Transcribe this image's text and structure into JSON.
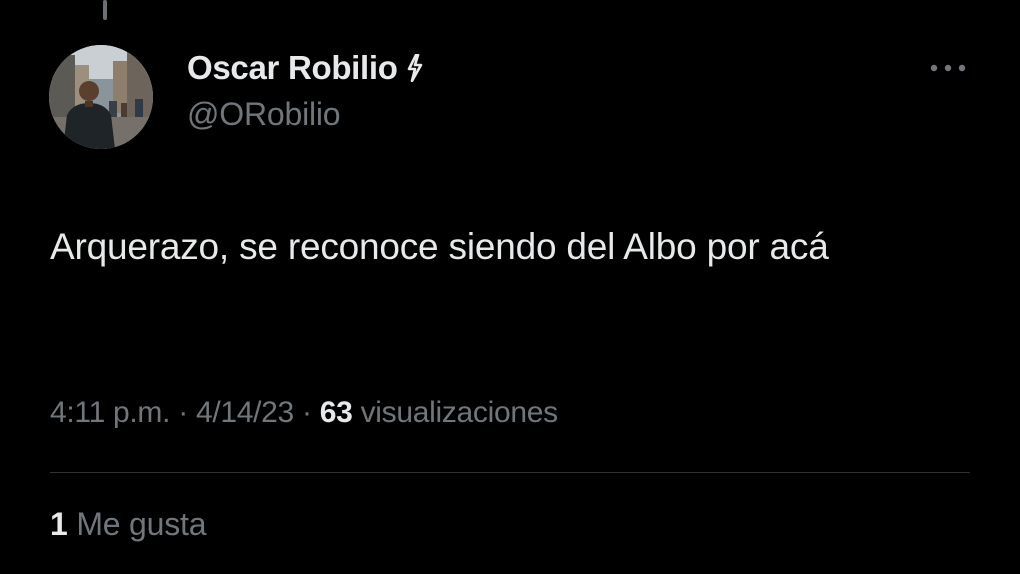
{
  "tweet": {
    "author": {
      "display_name": "Oscar Robilio",
      "badge_icon": "lightning-bolt-icon",
      "handle": "@ORobilio"
    },
    "more_icon": "more-options-icon",
    "text": "Arquerazo, se reconoce siendo del Albo por acá",
    "meta": {
      "time": "4:11 p.m.",
      "separator": "·",
      "date": "4/14/23",
      "views_count": "63",
      "views_label": "visualizaciones"
    },
    "engagement": {
      "likes_count": "1",
      "likes_label": "Me gusta"
    }
  },
  "colors": {
    "background": "#000000",
    "primary_text": "#e7e9ea",
    "secondary_text": "#71767b",
    "divider": "#2f3336"
  }
}
